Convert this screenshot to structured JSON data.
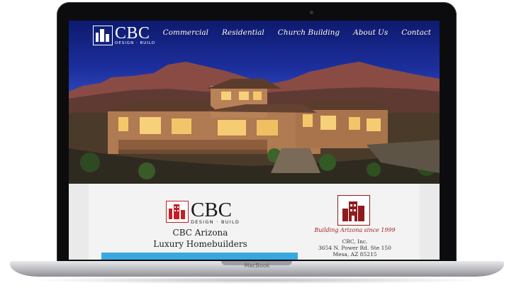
{
  "device": {
    "base_label": "MacBook"
  },
  "site": {
    "logo": {
      "text": "CBC",
      "tagline": "DESIGN · BUILD"
    },
    "nav": [
      {
        "label": "Commercial"
      },
      {
        "label": "Residential"
      },
      {
        "label": "Church Building"
      },
      {
        "label": "About Us"
      },
      {
        "label": "Contact"
      }
    ]
  },
  "content": {
    "logo": {
      "text": "CBC",
      "tagline": "DESIGN · BUILD"
    },
    "heading_line1": "CBC Arizona",
    "heading_line2": "Luxury Homebuilders",
    "badge_tagline": "Building Arizona since 1999",
    "address": {
      "company": "CBC, Inc.",
      "street": "3654 N. Power Rd. Ste 150",
      "city": "Mesa, AZ 85215"
    }
  },
  "colors": {
    "accent_red": "#c22026",
    "accent_blue": "#3aa8e0",
    "sky_blue": "#1d2f9e"
  }
}
